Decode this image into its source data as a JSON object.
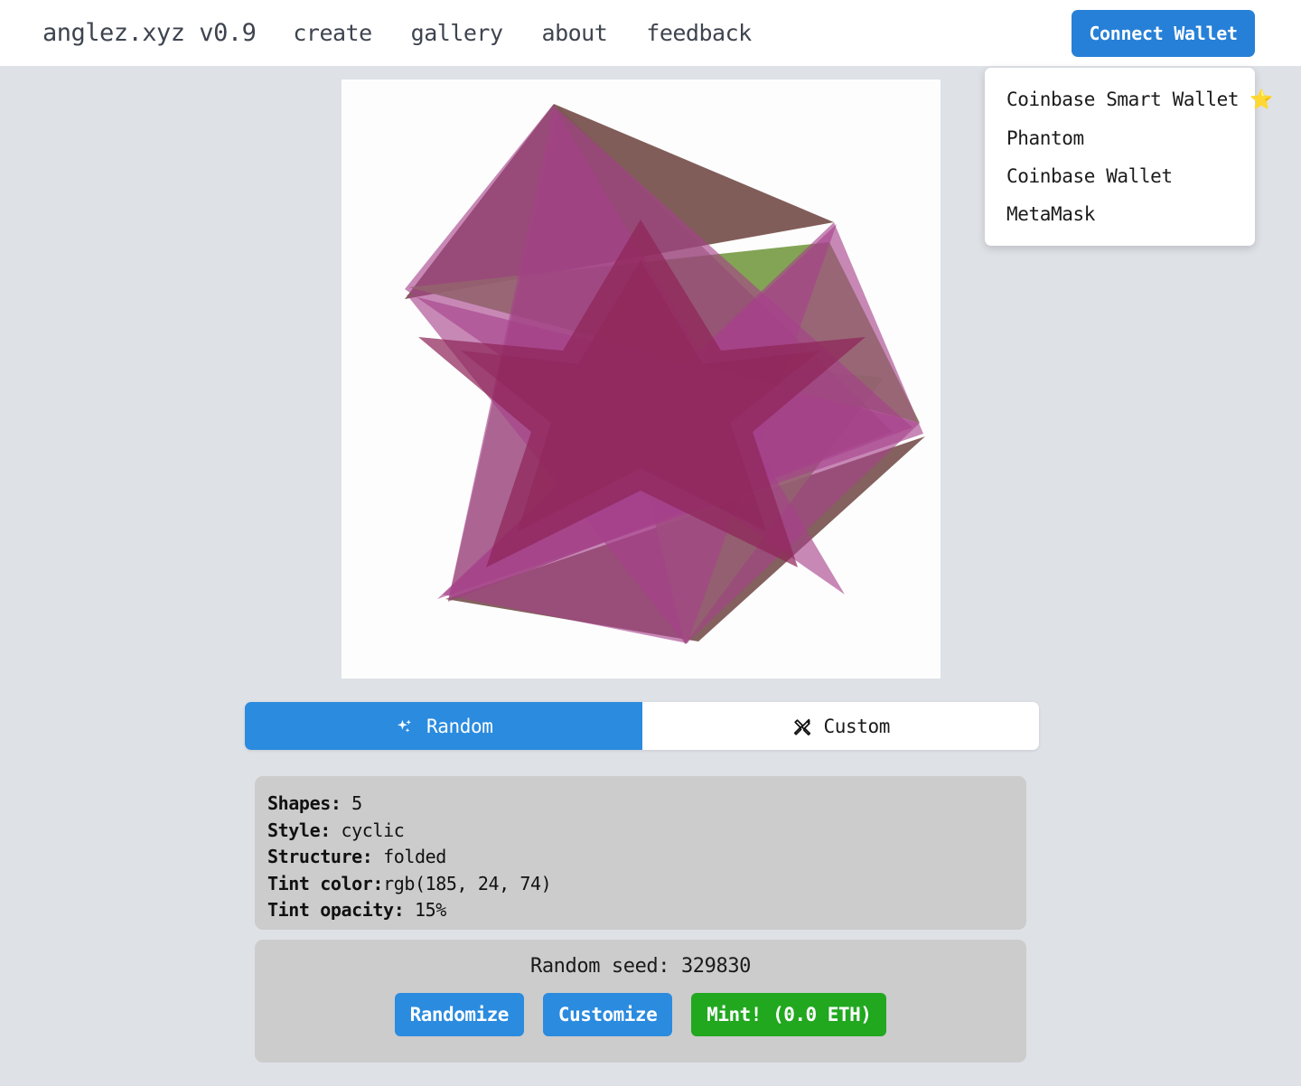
{
  "header": {
    "brand": "anglez.xyz v0.9",
    "nav": [
      {
        "label": "create"
      },
      {
        "label": "gallery"
      },
      {
        "label": "about"
      },
      {
        "label": "feedback"
      }
    ],
    "connect_wallet_label": "Connect Wallet",
    "accent_blue": "#2680d8"
  },
  "wallet_dropdown": {
    "options": [
      {
        "label": "Coinbase Smart Wallet ⭐"
      },
      {
        "label": "Phantom"
      },
      {
        "label": "Coinbase Wallet"
      },
      {
        "label": "MetaMask"
      }
    ]
  },
  "tabs": {
    "random": {
      "label": "Random",
      "icon": "sparkles-icon",
      "active": true
    },
    "custom": {
      "label": "Custom",
      "icon": "pencil-ruler-icon",
      "active": false
    }
  },
  "info": {
    "rows": [
      {
        "label": "Shapes:",
        "value": " 5"
      },
      {
        "label": "Style:",
        "value": " cyclic"
      },
      {
        "label": "Structure:",
        "value": " folded"
      },
      {
        "label": "Tint color:",
        "value": "rgb(185, 24, 74)"
      },
      {
        "label": "Tint opacity:",
        "value": " 15%"
      }
    ]
  },
  "seed": {
    "text": "Random seed: 329830",
    "buttons": [
      {
        "label": "Randomize",
        "color": "#2a8bdf"
      },
      {
        "label": "Customize",
        "color": "#2a8bdf"
      },
      {
        "label": "Mint! (0.0 ETH)",
        "color": "#21a81f"
      }
    ]
  },
  "artwork": {
    "background": "#fdfdfd",
    "tint_color": "rgb(185, 24, 74)",
    "tint_opacity": "15%",
    "shape_count": 5,
    "style": "cyclic",
    "structure": "folded",
    "palette": {
      "magenta_light": "#b2619a",
      "magenta_deep": "#8f2659",
      "green": "#769a42",
      "brown": "#7a5450"
    }
  }
}
